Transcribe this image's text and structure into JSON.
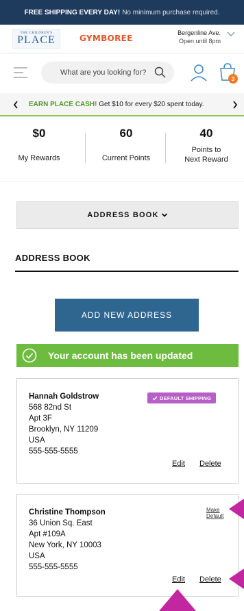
{
  "promo": {
    "bold": "FREE SHIPPING EVERY DAY!",
    "light": "No minimum purchase required."
  },
  "brand": {
    "tcp_small": "THE CHILDREN'S",
    "tcp_big": "PLACE",
    "gymboree": "GYMBOREE",
    "store_address": "Bergenline Ave.",
    "store_hours": "Open until 8pm"
  },
  "search": {
    "placeholder": "What are you looking for?"
  },
  "cart": {
    "count": "3"
  },
  "cash_banner": {
    "bold": "EARN PLACE CASH!",
    "text": "Get $10 for every $20 spent today."
  },
  "rewards": [
    {
      "value": "$0",
      "label": "My Rewards"
    },
    {
      "value": "60",
      "label": "Current Points"
    },
    {
      "value": "40",
      "label_line1": "Points to",
      "label_line2": "Next Reward"
    }
  ],
  "nav_dropdown": {
    "label": "ADDRESS BOOK"
  },
  "section_title": "ADDRESS BOOK",
  "add_button": "ADD NEW ADDRESS",
  "success_message": "Your account has been updated",
  "addresses": [
    {
      "name": "Hannah Goldstrow",
      "line1": "568 82nd St",
      "line2": "Apt 3F",
      "city": "Brooklyn, NY 11209",
      "country": "USA",
      "phone": "555-555-5555",
      "badge": "DEFAULT SHIPPING",
      "edit": "Edit",
      "delete": "Delete"
    },
    {
      "name": "Christine Thompson",
      "line1": "36 Union Sq. East",
      "line2": "Apt #109A",
      "city": "New York, NY 10003",
      "country": "USA",
      "phone": "555-555-5555",
      "make_default": "Make Default",
      "edit": "Edit",
      "delete": "Delete"
    }
  ],
  "colors": {
    "promo_bg": "#1e3a5c",
    "primary_button": "#2f6690",
    "success_green": "#6dbb3f",
    "default_badge": "#b65fc6",
    "annotation_pointer": "#c2279f",
    "brand_blue": "#2f5d94",
    "brand_orange": "#e1542a",
    "cart_badge": "#f07a22"
  },
  "icons": [
    "hamburger-icon",
    "search-icon",
    "account-icon",
    "shopping-bag-icon",
    "chevron-left-icon",
    "chevron-right-icon",
    "chevron-down-icon",
    "checkmark-circle-icon",
    "checkmark-icon"
  ]
}
